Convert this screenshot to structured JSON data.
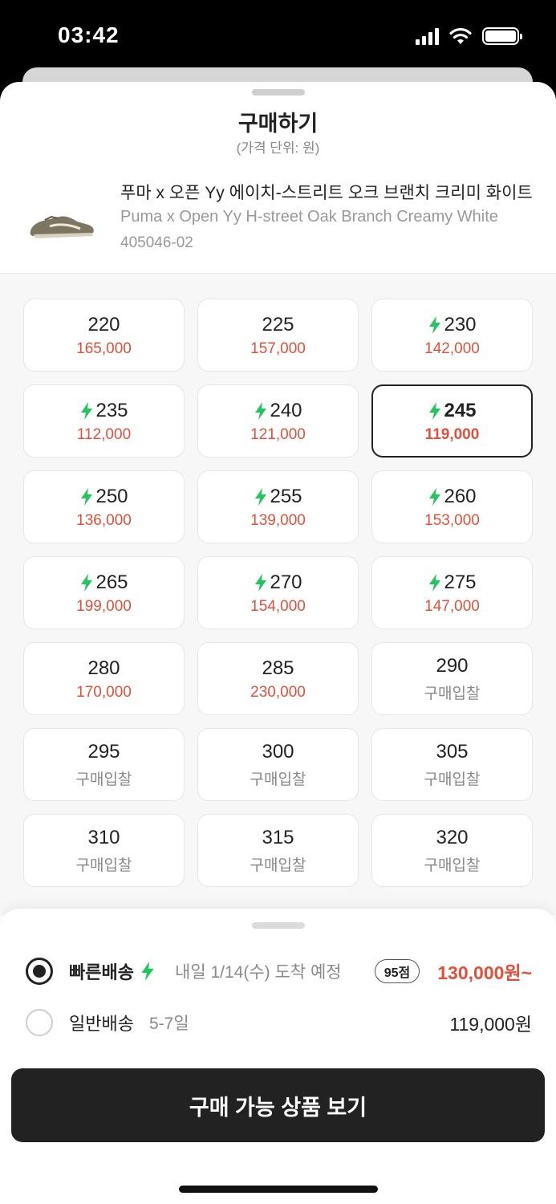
{
  "status_bar": {
    "time": "03:42"
  },
  "sheet": {
    "title": "구매하기",
    "subtitle": "(가격 단위: 원)"
  },
  "product": {
    "name": "푸마 x 오픈 Yy 에이치-스트리트 오크 브랜치 크리미 화이트",
    "english_name": "Puma x Open Yy H-street Oak Branch Creamy White",
    "code": "405046-02"
  },
  "colors": {
    "price_red": "#e2503c",
    "bolt_green": "#22c55e",
    "dark": "#222222"
  },
  "sizes": [
    {
      "size": "220",
      "price": "165,000",
      "fast": false,
      "bid": false
    },
    {
      "size": "225",
      "price": "157,000",
      "fast": false,
      "bid": false
    },
    {
      "size": "230",
      "price": "142,000",
      "fast": true,
      "bid": false
    },
    {
      "size": "235",
      "price": "112,000",
      "fast": true,
      "bid": false
    },
    {
      "size": "240",
      "price": "121,000",
      "fast": true,
      "bid": false
    },
    {
      "size": "245",
      "price": "119,000",
      "fast": true,
      "bid": false,
      "selected": true
    },
    {
      "size": "250",
      "price": "136,000",
      "fast": true,
      "bid": false
    },
    {
      "size": "255",
      "price": "139,000",
      "fast": true,
      "bid": false
    },
    {
      "size": "260",
      "price": "153,000",
      "fast": true,
      "bid": false
    },
    {
      "size": "265",
      "price": "199,000",
      "fast": true,
      "bid": false
    },
    {
      "size": "270",
      "price": "154,000",
      "fast": true,
      "bid": false
    },
    {
      "size": "275",
      "price": "147,000",
      "fast": true,
      "bid": false
    },
    {
      "size": "280",
      "price": "170,000",
      "fast": false,
      "bid": false
    },
    {
      "size": "285",
      "price": "230,000",
      "fast": false,
      "bid": false
    },
    {
      "size": "290",
      "price": "구매입찰",
      "fast": false,
      "bid": true
    },
    {
      "size": "295",
      "price": "구매입찰",
      "fast": false,
      "bid": true
    },
    {
      "size": "300",
      "price": "구매입찰",
      "fast": false,
      "bid": true
    },
    {
      "size": "305",
      "price": "구매입찰",
      "fast": false,
      "bid": true
    },
    {
      "size": "310",
      "price": "구매입찰",
      "fast": false,
      "bid": true
    },
    {
      "size": "315",
      "price": "구매입찰",
      "fast": false,
      "bid": true
    },
    {
      "size": "320",
      "price": "구매입찰",
      "fast": false,
      "bid": true
    }
  ],
  "shipping": {
    "fast": {
      "label": "빠른배송",
      "icon": "bolt-icon",
      "note": "내일 1/14(수) 도착 예정",
      "score": "95점",
      "price": "130,000원~",
      "selected": true
    },
    "normal": {
      "label": "일반배송",
      "note": "5-7일",
      "price": "119,000원",
      "selected": false
    }
  },
  "cta": {
    "label": "구매 가능 상품 보기"
  }
}
